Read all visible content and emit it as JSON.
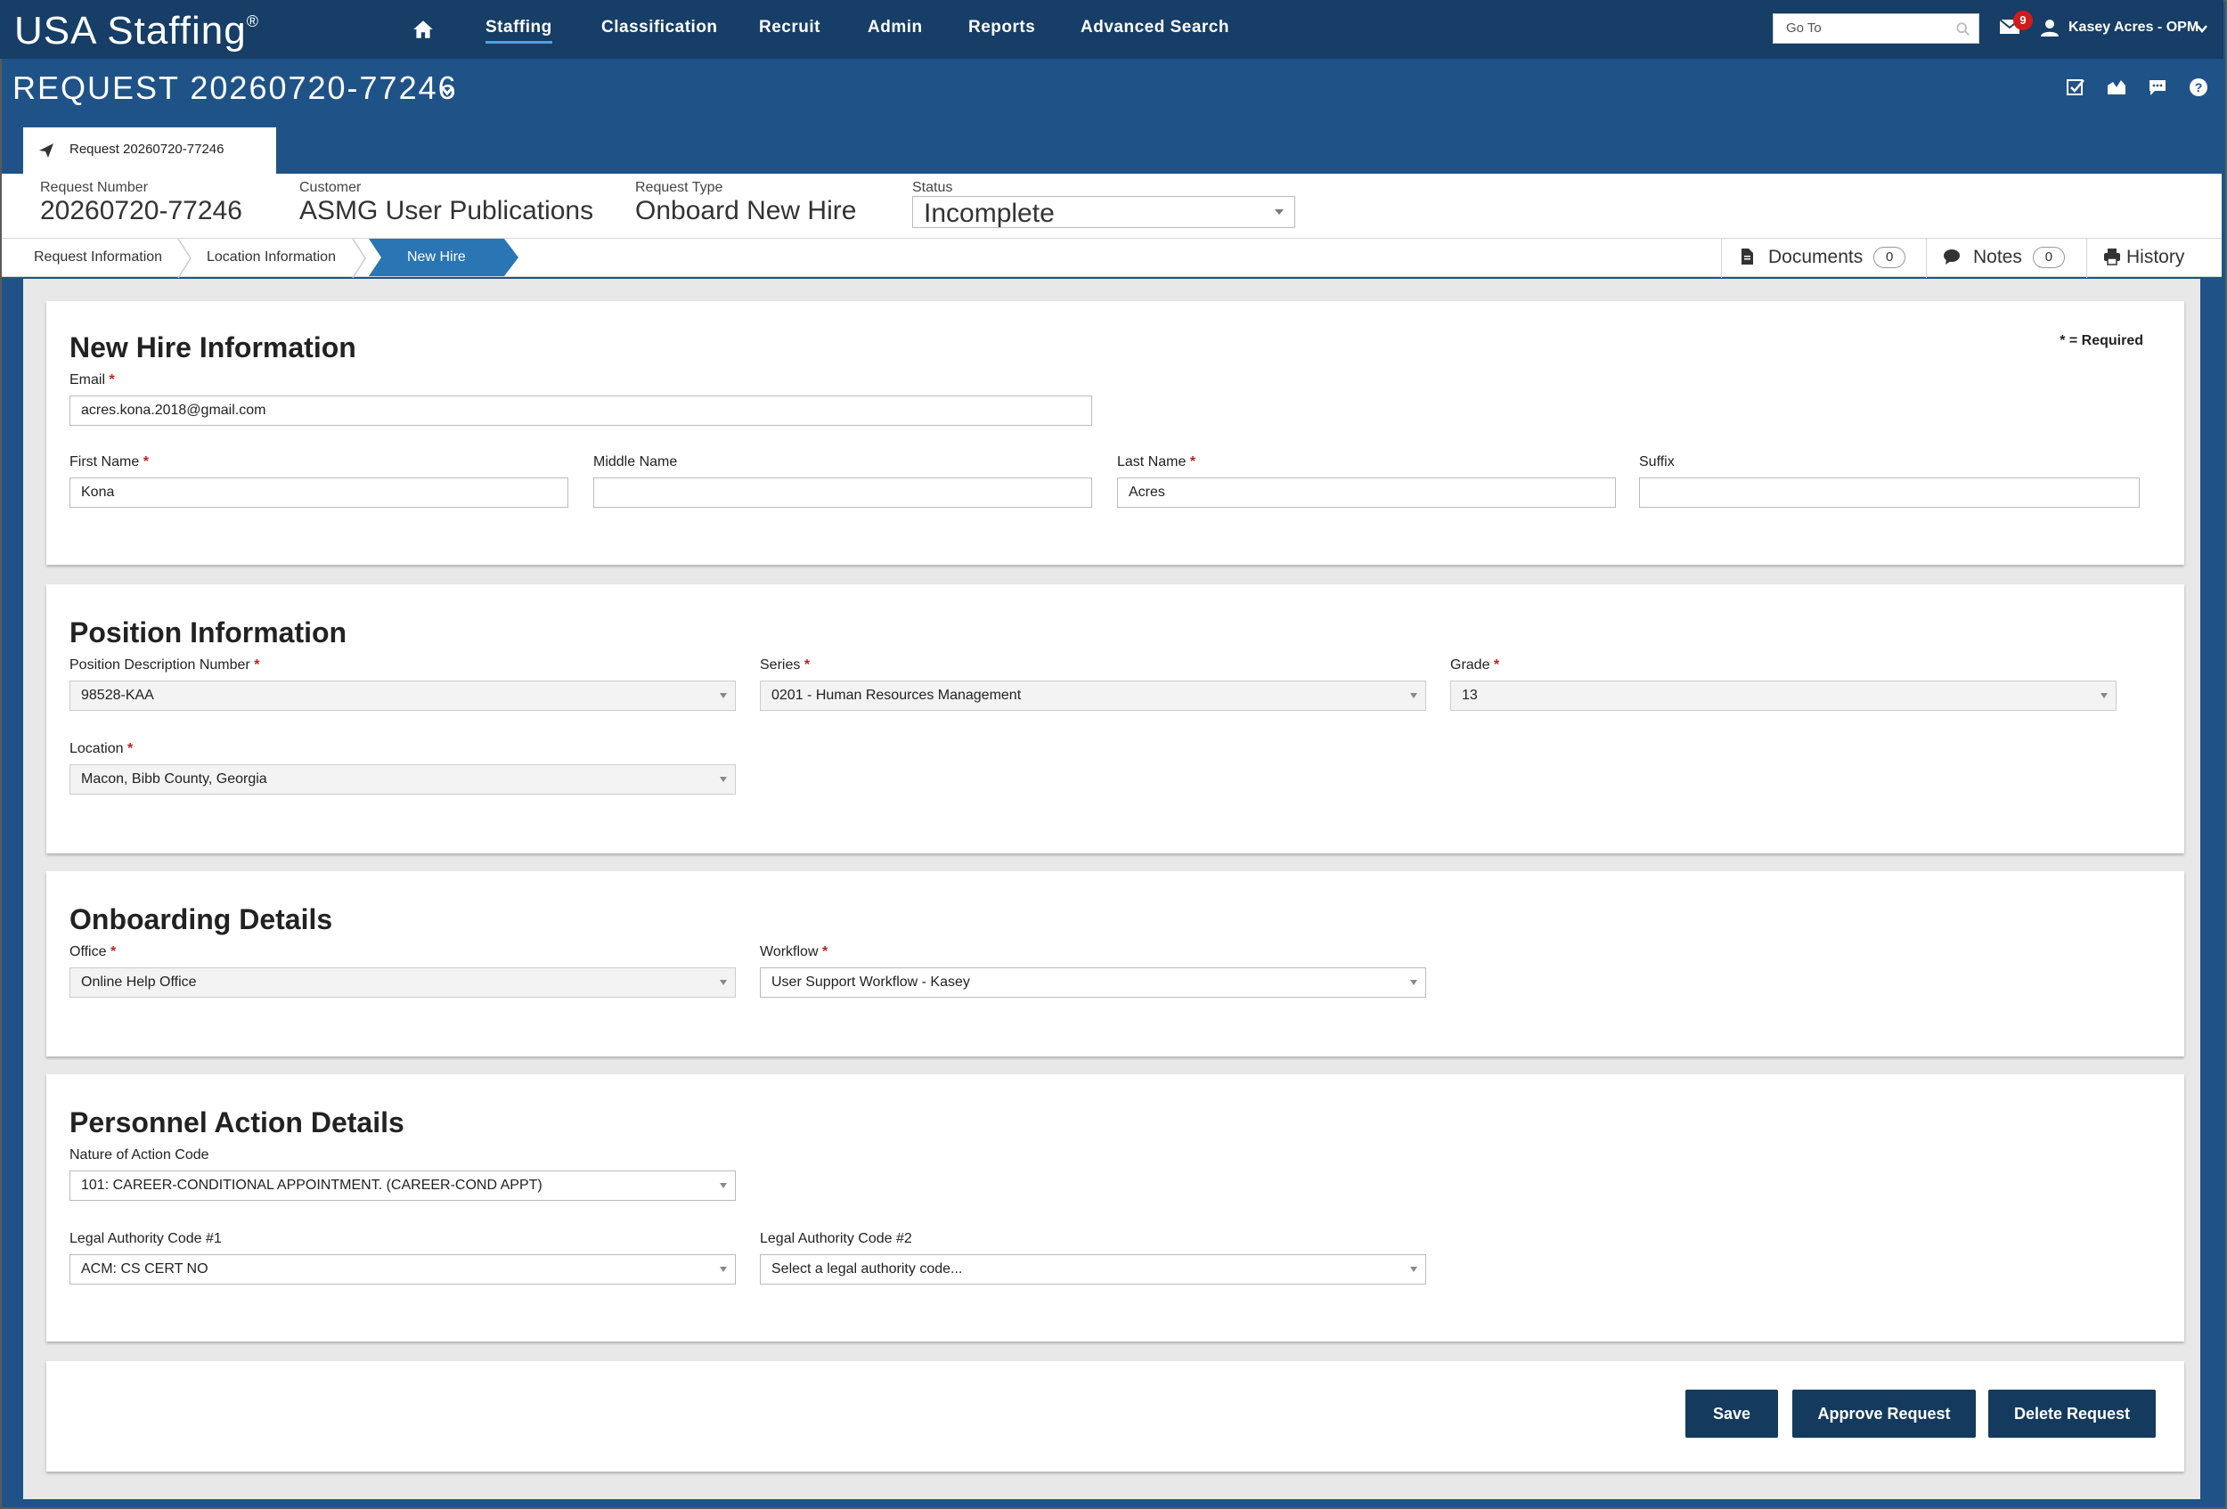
{
  "app": {
    "brand": "USA Staffing",
    "brand_mark": "®"
  },
  "nav": {
    "items": [
      "Staffing",
      "Classification",
      "Recruit",
      "Admin",
      "Reports",
      "Advanced Search"
    ],
    "active": "Staffing",
    "goto_placeholder": "Go To",
    "mail_count": "9",
    "user_name": "Kasey Acres - OPM"
  },
  "request": {
    "title": "REQUEST 20260720-77246",
    "tab_label": "Request 20260720-77246"
  },
  "summary": {
    "request_number_label": "Request Number",
    "request_number": "20260720-77246",
    "customer_label": "Customer",
    "customer": "ASMG User Publications",
    "request_type_label": "Request Type",
    "request_type": "Onboard New Hire",
    "status_label": "Status",
    "status": "Incomplete"
  },
  "breadcrumbs": {
    "items": [
      "Request Information",
      "Location Information",
      "New Hire"
    ],
    "active": "New Hire"
  },
  "side_tabs": {
    "documents_label": "Documents",
    "documents_count": "0",
    "notes_label": "Notes",
    "notes_count": "0",
    "history_label": "History"
  },
  "new_hire": {
    "heading": "New Hire Information",
    "required_note": "* = Required",
    "email_label": "Email",
    "email": "acres.kona.2018@gmail.com",
    "first_name_label": "First Name",
    "first_name": "Kona",
    "middle_name_label": "Middle Name",
    "middle_name": "",
    "last_name_label": "Last Name",
    "last_name": "Acres",
    "suffix_label": "Suffix",
    "suffix": ""
  },
  "position": {
    "heading": "Position Information",
    "pd_label": "Position Description Number",
    "pd_value": "98528-KAA",
    "series_label": "Series",
    "series_value": "0201 - Human Resources Management",
    "grade_label": "Grade",
    "grade_value": "13",
    "location_label": "Location",
    "location_value": "Macon, Bibb County, Georgia"
  },
  "onboarding": {
    "heading": "Onboarding Details",
    "office_label": "Office",
    "office_value": "Online Help Office",
    "workflow_label": "Workflow",
    "workflow_value": "User Support Workflow - Kasey"
  },
  "personnel": {
    "heading": "Personnel Action Details",
    "noa_label": "Nature of Action Code",
    "noa_value": "101: CAREER-CONDITIONAL APPOINTMENT. (CAREER-COND APPT)",
    "la1_label": "Legal Authority Code #1",
    "la1_value": "ACM: CS CERT NO",
    "la2_label": "Legal Authority Code #2",
    "la2_value": "Select a legal authority code..."
  },
  "actions": {
    "save": "Save",
    "approve": "Approve Request",
    "delete": "Delete Request"
  },
  "colors": {
    "navbar": "#163e66",
    "header": "#1f5388",
    "active_crumb": "#2a75b3",
    "button": "#143a5e",
    "required_star": "#c41f1f"
  }
}
